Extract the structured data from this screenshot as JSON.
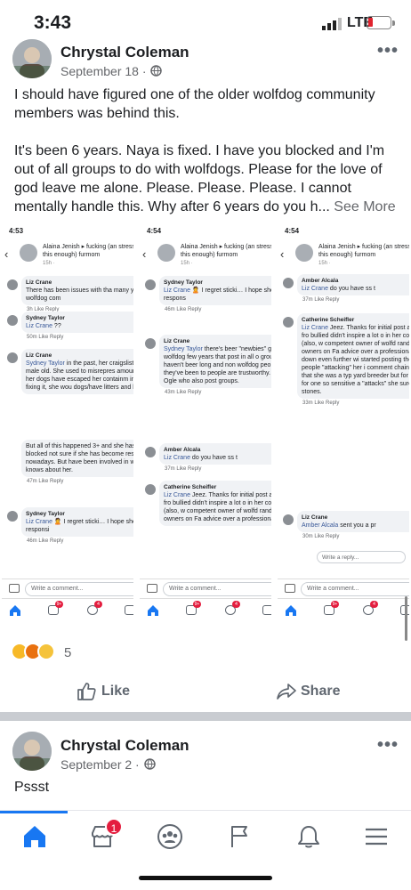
{
  "status_bar": {
    "time": "3:43",
    "network": "LTE"
  },
  "post1": {
    "author": "Chrystal Coleman",
    "date": "September 18 ·",
    "more": "•••",
    "paragraph1": "I should have figured one of the older wolfdog community members was behind this.",
    "paragraph2": "It's been 6 years. Naya is fixed. I have you blocked and I'm out of all groups to do with wolfdogs. Please for the love of god leave me alone. Please. Please. Please. I cannot mentally handle this. Why after 6 years do you h...",
    "see_more": "See More",
    "reaction_count": "5",
    "like_label": "Like",
    "share_label": "Share"
  },
  "screenshots": [
    {
      "time": "4:53",
      "nav_title": "Alaina Jenish ▸ fucking (an stress this enough) furmom",
      "nav_sub": "15h ·",
      "comments": [
        {
          "author": "Liz Crane",
          "text": "There has been issues with tha many years in the wolfdog com",
          "meta": "3h   Like   Reply"
        },
        {
          "author": "Sydney Taylor",
          "mention": "Liz Crane",
          "text": "??",
          "meta": "50m   Like   Reply"
        },
        {
          "author": "Liz Crane",
          "mention": "Sydney Taylor",
          "text": "in the past, her craigslist dog to a male old. She used to misrepres amount of wolf in her dogs have escaped her containm instead of fixing it, she wou dogs/have litters and keep",
          "meta": ""
        },
        {
          "author": "",
          "text": "But all of this happened 3+ and she has since blocked not sure if she has become responsible nowadays. But have been involved in wolfd 3 years knows about her.",
          "meta": "47m   Like   Reply"
        },
        {
          "author": "Sydney Taylor",
          "mention": "Liz Crane",
          "text": "🙎 I regret sticki… I hope she's more responsi",
          "meta": "46m   Like   Reply"
        }
      ],
      "compose": "Write a comment...",
      "badges": [
        "9+",
        "4"
      ]
    },
    {
      "time": "4:54",
      "nav_title": "Alaina Jenish ▸ fucking (an stress this enough) furmom",
      "nav_sub": "15h ·",
      "comments": [
        {
          "author": "Sydney Taylor",
          "mention": "Liz Crane",
          "text": "🙎 I regret sticki… I hope she's more respons",
          "meta": "46m   Like   Reply"
        },
        {
          "author": "Liz Crane",
          "mention": "Sydney Taylor",
          "text": "there's beer \"newbies\" getting wolfdog few years that post in all o groups. Many haven't beer long and non wolfdog peo everything they've been to people are trustworthy. Lik Kieren Ogle who also post groups.",
          "meta": "43m   Like   Reply"
        },
        {
          "author": "Amber Alcala",
          "mention": "Liz Crane",
          "text": "do you have ss t",
          "meta": "37m   Like   Reply"
        },
        {
          "author": "Catherine Scheifler",
          "mention": "Liz Crane",
          "text": "Jeez. Thanks for initial post about crying fro bullied didn't inspire a lot o in her competence (also, w competent owner of wolfd random dog owners on Fa advice over a professional?",
          "meta": ""
        }
      ],
      "compose": "Write a comment...",
      "badges": [
        "9+",
        "4"
      ]
    },
    {
      "time": "4:54",
      "nav_title": "Alaina Jenish ▸ fucking (an stress this enough) furmom",
      "nav_sub": "15h ·",
      "comments": [
        {
          "author": "Amber Alcala",
          "mention": "Liz Crane",
          "text": "do you have ss t",
          "meta": "37m   Like   Reply"
        },
        {
          "author": "Catherine Scheifler",
          "mention": "Liz Crane",
          "text": "Jeez. Thanks for initial post about crying fro bullied didn't inspire a lot o in her competence (also, w competent owner of wolfd random dog owners on Fa advice over a professional? went down even further wi started posting the same 6 of people \"attacking\" her i comment chain. Reading that she was a typ yard breeder but for wolfdo Also, for one so sensitive a \"attacks\" she sure throws a stones.",
          "meta": "33m   Like   Reply"
        },
        {
          "author": "Liz Crane",
          "mention": "Amber Alcala",
          "text": "sent you a pr",
          "meta": "30m   Like   Reply"
        }
      ],
      "compose": "Write a comment...",
      "reply_placeholder": "Write a reply...",
      "badges": [
        "9+",
        "4"
      ]
    }
  ],
  "post2": {
    "author": "Chrystal Coleman",
    "date": "September 2 ·",
    "more": "•••",
    "text": "Pssst"
  },
  "bottom_nav": {
    "marketplace_badge": "1"
  },
  "colors": {
    "accent": "#1877f2",
    "badge": "#e41e3f",
    "divider": "#c9ccd1"
  }
}
